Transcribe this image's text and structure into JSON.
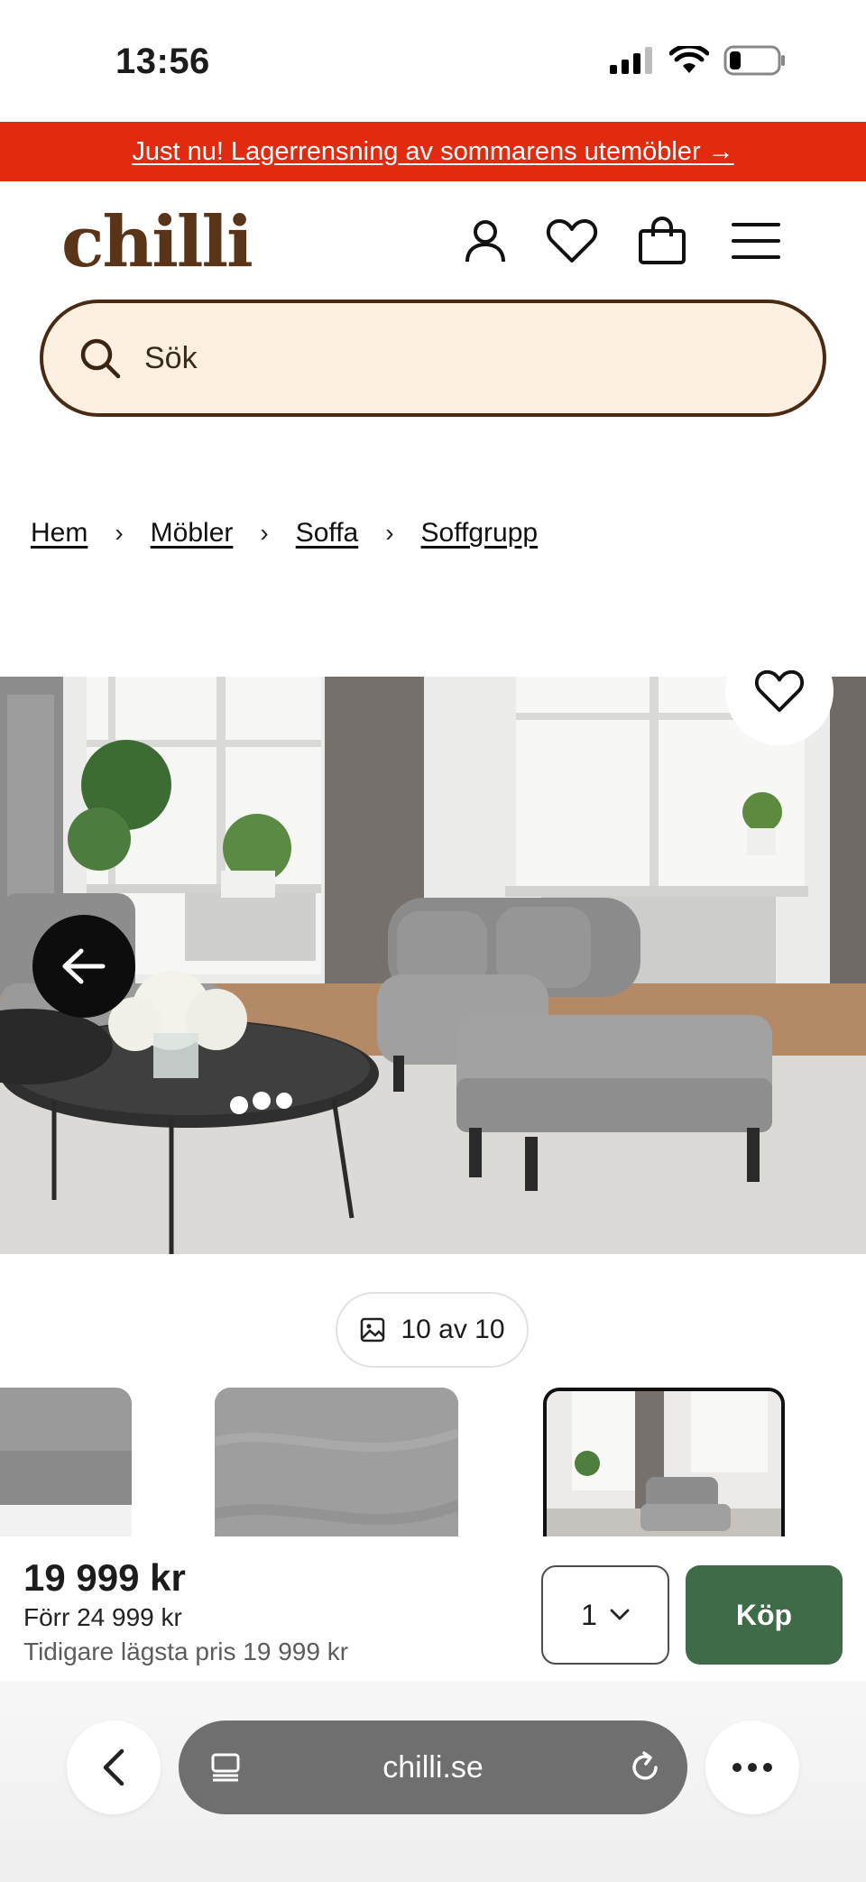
{
  "status_bar": {
    "time": "13:56"
  },
  "promo": {
    "text": "Just nu! Lagerrensning av sommarens utemöbler →"
  },
  "header": {
    "logo": "chilli",
    "icons": [
      "account-icon",
      "heart-icon",
      "bag-icon",
      "menu-icon"
    ]
  },
  "search": {
    "placeholder": "Sök"
  },
  "breadcrumb": {
    "items": [
      "Hem",
      "Möbler",
      "Soffa",
      "Soffgrupp"
    ],
    "separator": "›"
  },
  "gallery": {
    "counter": "10 av 10"
  },
  "purchase": {
    "price": "19 999 kr",
    "previous_price": "Förr 24 999 kr",
    "lowest_price": "Tidigare lägsta pris 19 999 kr",
    "quantity": "1",
    "buy_label": "Köp"
  },
  "browser": {
    "url": "chilli.se"
  },
  "colors": {
    "promo": "#e22b0e",
    "brand": "#5a3418",
    "search_bg": "#fdefe2",
    "buy": "#3f6b49"
  }
}
